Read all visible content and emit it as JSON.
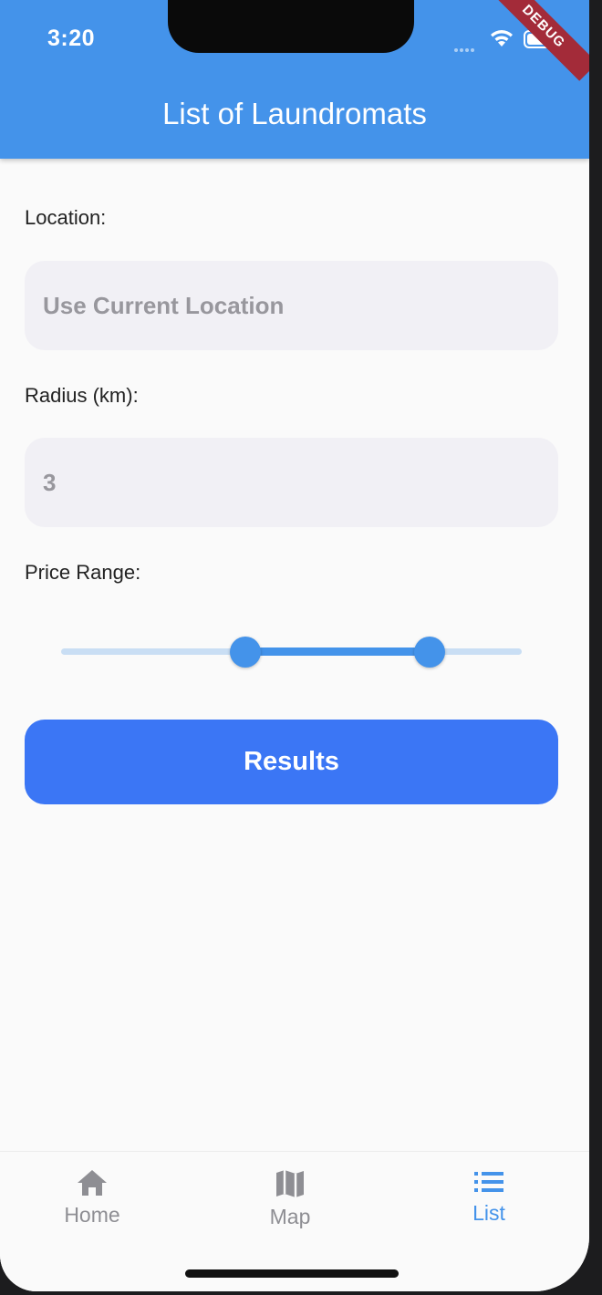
{
  "status_bar": {
    "time": "3:20"
  },
  "debug_banner": "DEBUG",
  "app_bar": {
    "title": "List of Laundromats"
  },
  "form": {
    "location_label": "Location:",
    "location_placeholder": "Use Current Location",
    "radius_label": "Radius (km):",
    "radius_value": "3",
    "price_label": "Price Range:",
    "price_range": {
      "min": 0,
      "max": 1,
      "start_fraction": 0.4,
      "end_fraction": 0.8
    },
    "results_button": "Results"
  },
  "bottom_nav": {
    "items": [
      {
        "label": "Home",
        "icon": "home-icon",
        "active": false
      },
      {
        "label": "Map",
        "icon": "map-icon",
        "active": false
      },
      {
        "label": "List",
        "icon": "list-icon",
        "active": true
      }
    ],
    "active_color": "#4493ea",
    "inactive_color": "#8e8e93"
  },
  "colors": {
    "app_bar": "#4493ea",
    "button": "#3b76f5",
    "field": "#f1f0f5"
  }
}
